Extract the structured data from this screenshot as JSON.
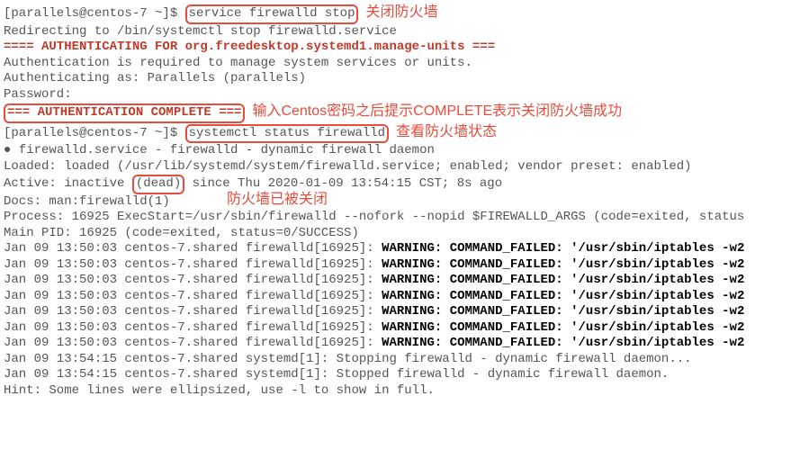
{
  "prompt1_user": "[parallels@centos-7 ~]$ ",
  "cmd1": "service firewalld stop",
  "annotation1": "关闭防火墙",
  "redirect_line": "Redirecting to /bin/systemctl stop firewalld.service",
  "auth_header": "==== AUTHENTICATING FOR org.freedesktop.systemd1.manage-units ===",
  "auth_required": "Authentication is required to manage system services or units.",
  "auth_as": "Authenticating as: Parallels (parallels)",
  "password_label": "Password:",
  "auth_complete": "=== AUTHENTICATION COMPLETE ===",
  "annotation2": "输入Centos密码之后提示COMPLETE表示关闭防火墙成功",
  "prompt2_user": "[parallels@centos-7 ~]$ ",
  "cmd2": "systemctl status firewalld",
  "annotation3": "查看防火墙状态",
  "service_line_bullet": "● ",
  "service_line": "firewalld.service - firewalld - dynamic firewall daemon",
  "loaded_line": "   Loaded: loaded (/usr/lib/systemd/system/firewalld.service; enabled; vendor preset: enabled)",
  "active_prefix": "   Active: inactive ",
  "active_dead": "(dead)",
  "active_suffix": " since Thu 2020-01-09 13:54:15 CST; 8s ago",
  "annotation4": "防火墙已被关闭",
  "docs_line": "     Docs: man:firewalld(1)",
  "process_line": "  Process: 16925 ExecStart=/usr/sbin/firewalld --nofork --nopid $FIREWALLD_ARGS (code=exited, status",
  "mainpid_line": " Main PID: 16925 (code=exited, status=0/SUCCESS)",
  "blank": " ",
  "log_prefix": "Jan 09 13:50:03 centos-7.shared firewalld[16925]: ",
  "log_warning": "WARNING: COMMAND_FAILED: '/usr/sbin/iptables -w2 ",
  "log_stop1_prefix": "Jan 09 13:54:15 centos-7.shared systemd[1]: ",
  "log_stop1": "Stopping firewalld - dynamic firewall daemon...",
  "log_stop2_prefix": "Jan 09 13:54:15 centos-7.shared systemd[1]: ",
  "log_stop2": "Stopped firewalld - dynamic firewall daemon.",
  "hint_line": "Hint: Some lines were ellipsized, use -l to show in full."
}
